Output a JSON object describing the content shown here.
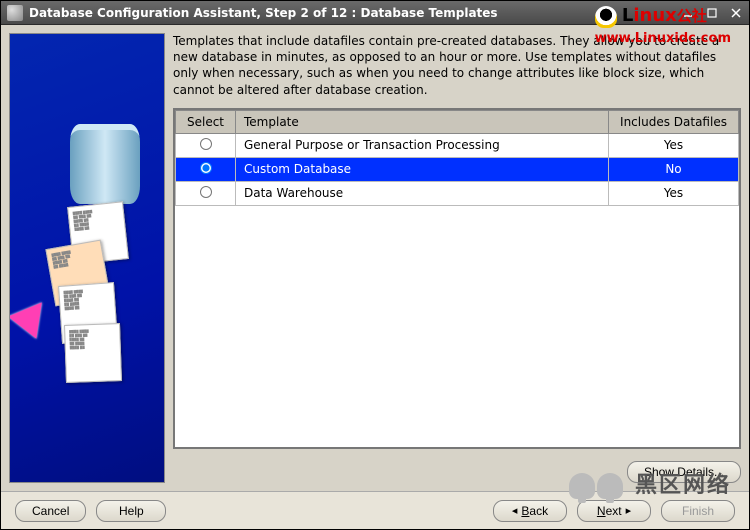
{
  "window": {
    "title": "Database Configuration Assistant, Step 2 of 12 : Database Templates"
  },
  "watermark": {
    "brand": "Linux",
    "brand_suffix": "公社",
    "url": "www.Linuxidc.com",
    "bottom": "黑区网络"
  },
  "intro": "Templates that include datafiles contain pre-created databases. They allow you to create a new database in minutes, as opposed to an hour or more. Use templates without datafiles only when necessary, such as when you need to change attributes like block size, which cannot be altered after database creation.",
  "table": {
    "headers": {
      "select": "Select",
      "template": "Template",
      "includes": "Includes Datafiles"
    },
    "rows": [
      {
        "name": "General Purpose or Transaction Processing",
        "includes": "Yes",
        "selected": false
      },
      {
        "name": "Custom Database",
        "includes": "No",
        "selected": true
      },
      {
        "name": "Data Warehouse",
        "includes": "Yes",
        "selected": false
      }
    ]
  },
  "buttons": {
    "show_details": "Show Details...",
    "cancel": "Cancel",
    "help": "Help",
    "back_full": "Back",
    "next_full": "Next",
    "finish": "Finish"
  }
}
